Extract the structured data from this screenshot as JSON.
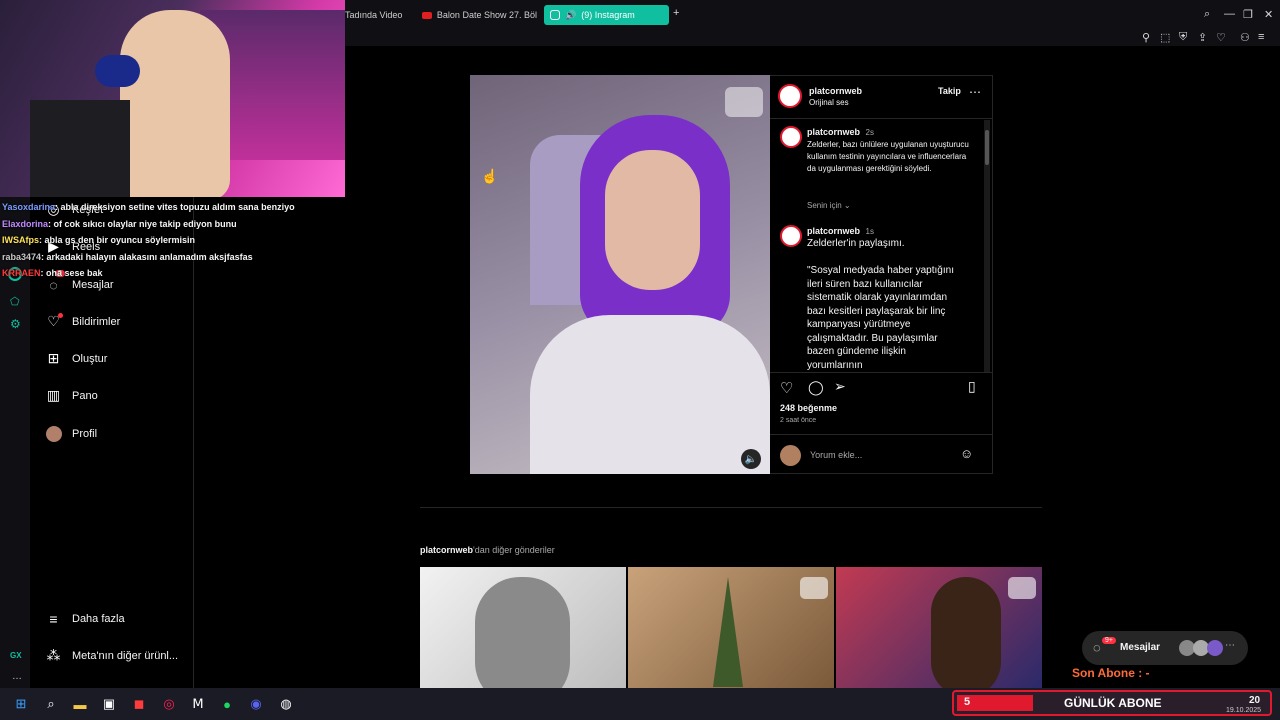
{
  "tabs": [
    {
      "label": "Tadında Video"
    },
    {
      "label": "Balon Date Show 27. Böl"
    },
    {
      "label": "(9) Instagram"
    }
  ],
  "chat": [
    {
      "user": "Yasoxdarina",
      "message": ": abla direksiyon setine vites topuzu aldım sana benziyo",
      "color": "#7a9cff"
    },
    {
      "user": "Elaxdorina",
      "message": ": of cok sıkıcı olaylar niye takip ediyon bunu",
      "color": "#c08aff"
    },
    {
      "user": "IWSAfps",
      "message": ": abla gs den bir oyuncu söylermisin",
      "color": "#ffe25a"
    },
    {
      "user": "raba3474",
      "message": ": arkadaki halayın alakasını anlamadım aksjfasfas",
      "color": "#c8c8c8"
    },
    {
      "user": "KRRAEN",
      "message": ": oha sese bak",
      "color": "#ff3c3c"
    }
  ],
  "sidebar": {
    "items": [
      {
        "label": "Keşfet",
        "icon": "compass-icon"
      },
      {
        "label": "Reels",
        "icon": "reels-icon"
      },
      {
        "label": "Mesajlar",
        "icon": "messenger-icon",
        "badge": "9"
      },
      {
        "label": "Bildirimler",
        "icon": "heart-icon"
      },
      {
        "label": "Oluştur",
        "icon": "plus-square-icon"
      },
      {
        "label": "Pano",
        "icon": "chart-icon"
      },
      {
        "label": "Profil",
        "icon": "avatar-icon"
      }
    ],
    "more": "Daha fazla",
    "meta": "Meta'nın diğer ürünl..."
  },
  "gx": {
    "label": "GX"
  },
  "post": {
    "username": "platcornweb",
    "audio": "Orijinal ses",
    "follow": "Takip",
    "caption_user": "platcornweb",
    "caption_time": "2s",
    "caption": "Zelderler, bazı ünlülere uygulanan uyuşturucu kullanım testinin yayıncılara ve influencerlara da uygulanması gerektiğini söyledi.",
    "for_you": "Senin için",
    "comment_user": "platcornweb",
    "comment_time": "1s",
    "comment_lead": "Zelderler'in paylaşımı.",
    "comment_body": "\"Sosyal medyada haber yaptığını ileri süren bazı kullanıcılar sistematik olarak yayınlarımdan bazı kesitleri paylaşarak bir linç kampanyası yürütmeye çalışmaktadır. Bu paylaşımlar bazen gündeme ilişkin yorumlarının",
    "likes": "248 beğenme",
    "time_ago": "2 saat önce",
    "comment_placeholder": "Yorum ekle..."
  },
  "more_posts": {
    "user": "platcornweb",
    "suffix": "'dan diğer gönderiler"
  },
  "messages_pill": {
    "label": "Mesajlar",
    "badge": "9+"
  },
  "overlay": {
    "son_abone": "Son Abone : -",
    "count": "5",
    "gunluk": "GÜNLÜK ABONE",
    "clock": "20",
    "date": "19.10.2025"
  },
  "colors": {
    "accent": "#0fbf9f",
    "instagram_red": "#ff3040",
    "follow_blue": "#0095f6"
  }
}
